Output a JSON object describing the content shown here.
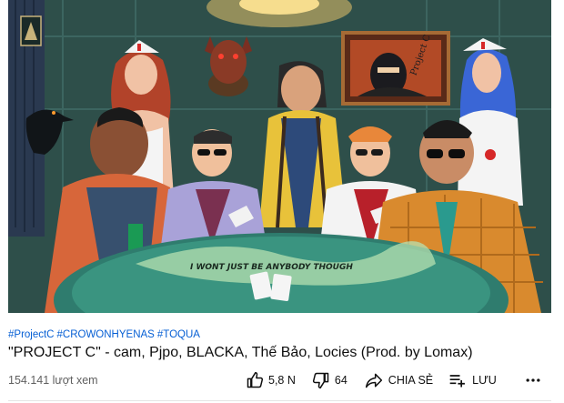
{
  "video": {
    "thumbnail_caption": "I WONT  JUST BE ANYBODY THOUGH",
    "wall_poster_text": "Project C"
  },
  "hashtags": [
    "#ProjectC",
    "#CROWONHYENAS",
    "#TOQUA"
  ],
  "title": "\"PROJECT C\" - cam, Pjpo, BLACKA, Thế Bảo, Locies (Prod. by Lomax)",
  "views": "154.141 lượt xem",
  "actions": {
    "like_count": "5,8 N",
    "dislike_count": "64",
    "share_label": "CHIA SẺ",
    "save_label": "LƯU"
  },
  "icons": {
    "like": "thumbs-up-icon",
    "dislike": "thumbs-down-icon",
    "share": "share-arrow-icon",
    "save": "add-to-playlist-icon",
    "more": "more-horizontal-icon"
  }
}
